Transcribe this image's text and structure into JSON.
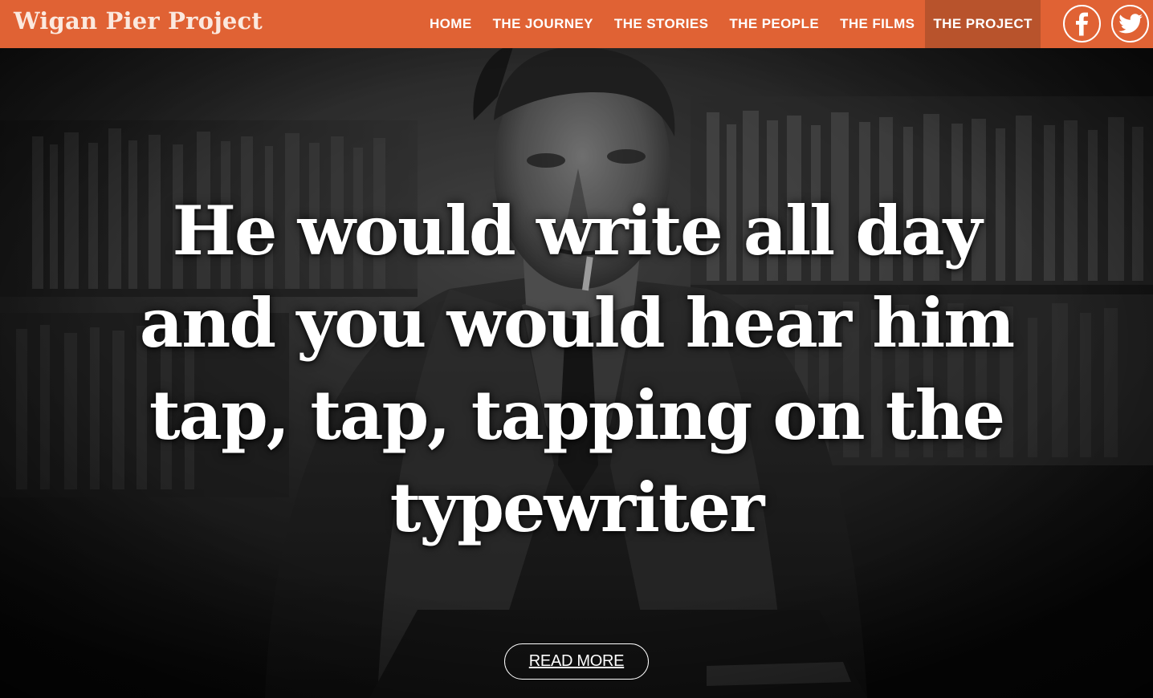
{
  "header": {
    "brand": "Wigan Pier Project",
    "nav": [
      {
        "label": "HOME",
        "active": false
      },
      {
        "label": "THE JOURNEY",
        "active": false
      },
      {
        "label": "THE STORIES",
        "active": false
      },
      {
        "label": "THE PEOPLE",
        "active": false
      },
      {
        "label": "THE FILMS",
        "active": false
      },
      {
        "label": "THE PROJECT",
        "active": true
      }
    ],
    "social": [
      {
        "icon": "facebook-icon"
      },
      {
        "icon": "twitter-icon"
      }
    ]
  },
  "hero": {
    "quote_lines": [
      "He would write all day",
      "and you would hear him",
      "tap, tap, tapping on the",
      "typewriter"
    ],
    "button_label": "READ MORE",
    "image": "black-and-white-photo-man-in-front-of-bookshelves"
  },
  "colors": {
    "header_bg": "#e06234",
    "active_nav_bg": "#b8532c",
    "brand_text": "#fbe9df",
    "text": "#ffffff"
  }
}
